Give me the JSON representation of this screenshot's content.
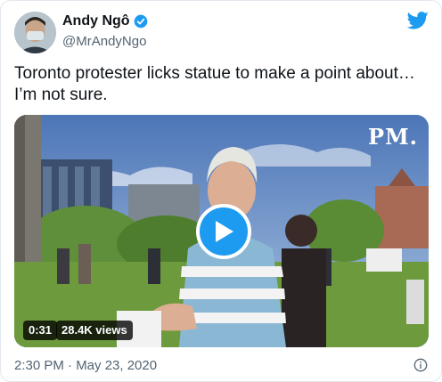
{
  "author": {
    "name": "Andy Ngô",
    "handle": "@MrAndyNgo"
  },
  "tweet": {
    "text": "Toronto protester licks statue to make a point about… I’m not sure."
  },
  "media": {
    "watermark": "PM.",
    "duration": "0:31",
    "views": "28.4K views"
  },
  "timestamp": "2:30 PM · May 23, 2020",
  "icons": {
    "verified": "verified-badge-icon",
    "platform": "twitter-bird-icon",
    "play": "play-icon",
    "info": "info-icon"
  },
  "colors": {
    "accent": "#1d9bf0",
    "text": "#0f1419",
    "secondary": "#536471"
  }
}
